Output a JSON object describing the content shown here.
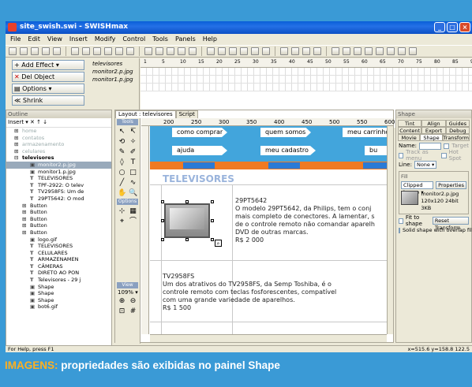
{
  "window": {
    "title": "site_swish.swi - SWISHmax"
  },
  "menu": [
    "File",
    "Edit",
    "View",
    "Insert",
    "Modify",
    "Control",
    "Tools",
    "Panels",
    "Help"
  ],
  "effects": {
    "add_effect": "Add Effect",
    "del_object": "Del Object",
    "options": "Options",
    "shrink": "Shrink"
  },
  "tracks": [
    "televisores",
    "monitor2.p.jpg",
    "monitor1.p.jpg"
  ],
  "timeline_ticks": [
    "1",
    "5",
    "10",
    "15",
    "20",
    "25",
    "30",
    "35",
    "40",
    "45",
    "50",
    "55",
    "60",
    "65",
    "70",
    "75",
    "80",
    "85",
    "90"
  ],
  "outline": {
    "title": "Outline",
    "toolbar": "Insert",
    "items": [
      {
        "label": "home",
        "cls": "i0 g",
        "icon": "⊞"
      },
      {
        "label": "contatos",
        "cls": "i0 g",
        "icon": "⊞"
      },
      {
        "label": "armazenamento",
        "cls": "i0 g",
        "icon": "⊞"
      },
      {
        "label": "celulares",
        "cls": "i0 g",
        "icon": "⊞"
      },
      {
        "label": "televisores",
        "cls": "i0 b",
        "icon": "⊟"
      },
      {
        "label": "monitor2.p.jpg",
        "cls": "i2 sel",
        "icon": "▣"
      },
      {
        "label": "monitor1.p.jpg",
        "cls": "i2",
        "icon": "▣"
      },
      {
        "label": "TELEVISORES",
        "cls": "i2",
        "icon": "T"
      },
      {
        "label": "TPF-2922: O telev",
        "cls": "i2",
        "icon": "T"
      },
      {
        "label": "TV2958FS: Um de",
        "cls": "i2",
        "icon": "T"
      },
      {
        "label": "29PT5642: O mod",
        "cls": "i2",
        "icon": "T"
      },
      {
        "label": "Button",
        "cls": "i1",
        "icon": "⊞"
      },
      {
        "label": "Button",
        "cls": "i1",
        "icon": "⊞"
      },
      {
        "label": "Button",
        "cls": "i1",
        "icon": "⊞"
      },
      {
        "label": "Button",
        "cls": "i1",
        "icon": "⊞"
      },
      {
        "label": "Button",
        "cls": "i1",
        "icon": "⊞"
      },
      {
        "label": "logo.gif",
        "cls": "i2",
        "icon": "▣"
      },
      {
        "label": "TELEVISORES",
        "cls": "i2",
        "icon": "T"
      },
      {
        "label": "CELULARES",
        "cls": "i2",
        "icon": "T"
      },
      {
        "label": "ARMAZENAMEN",
        "cls": "i2",
        "icon": "T"
      },
      {
        "label": "CÂMERAS",
        "cls": "i2",
        "icon": "T"
      },
      {
        "label": "DIRETO AO PON",
        "cls": "i2",
        "icon": "T"
      },
      {
        "label": "Televisores - 29 j",
        "cls": "i2",
        "icon": "T"
      },
      {
        "label": "Shape",
        "cls": "i2",
        "icon": "▣"
      },
      {
        "label": "Shape",
        "cls": "i2",
        "icon": "▣"
      },
      {
        "label": "Shape",
        "cls": "i2",
        "icon": "▣"
      },
      {
        "label": "bot6.gif",
        "cls": "i2",
        "icon": "▣"
      }
    ]
  },
  "workspace": {
    "tabs": [
      "Layout : televisores",
      "Script"
    ],
    "tools_label": "Tools",
    "options_label": "Options",
    "view_label": "View",
    "zoom": "109%",
    "ruler": [
      "200",
      "250",
      "300",
      "350",
      "400",
      "450",
      "500",
      "550",
      "600",
      "65"
    ],
    "nav": [
      "como comprar",
      "quem somos",
      "meu carrinho",
      "ajuda",
      "meu cadastro",
      "bu"
    ],
    "heading": "TELEVISORES",
    "product1": {
      "name": "29PT5642",
      "desc1": "O modelo 29PT5642, da Philips, tem o conj",
      "desc2": "mais completo de conectores. A lamentar, s",
      "desc3": "de o controle remoto não comandar aparelh",
      "desc4": "DVD de outras marcas.",
      "price": "R$ 2 000"
    },
    "product2": {
      "name": "TV2958FS",
      "desc1": "Um dos atrativos do TV2958FS, da Semp Toshiba, é o",
      "desc2": "controle remoto com teclas fosforescentes, compatível",
      "desc3": "com uma grande variedade de aparelhos.",
      "price": "R$ 1 500"
    }
  },
  "shape_panel": {
    "title": "Shape",
    "tabs": [
      "Tint",
      "Align",
      "Guides",
      "Content",
      "Export",
      "Debug",
      "Movie",
      "Shape",
      "Transform"
    ],
    "name_label": "Name:",
    "target": "Target",
    "track_as_menu": "Track as menu",
    "hot_spot": "Hot Spot",
    "line_label": "Line:",
    "line_value": "None",
    "fill_label": "Fill",
    "fill_type": "Clipped image",
    "properties": "Properties",
    "image_name": "monitor2.p.jpg",
    "image_info": "120x120 24bit 3KB",
    "fit_to_shape": "Fit to shape",
    "reset_transform": "Reset Transform",
    "solid_shape": "Solid shape with overlap filled"
  },
  "status": {
    "left": "For Help, press F1",
    "right": "x=515.6 y=158.8  122.5"
  },
  "caption": {
    "highlight": "IMAGENS:",
    "text": " propriedades são exibidas no painel Shape"
  }
}
